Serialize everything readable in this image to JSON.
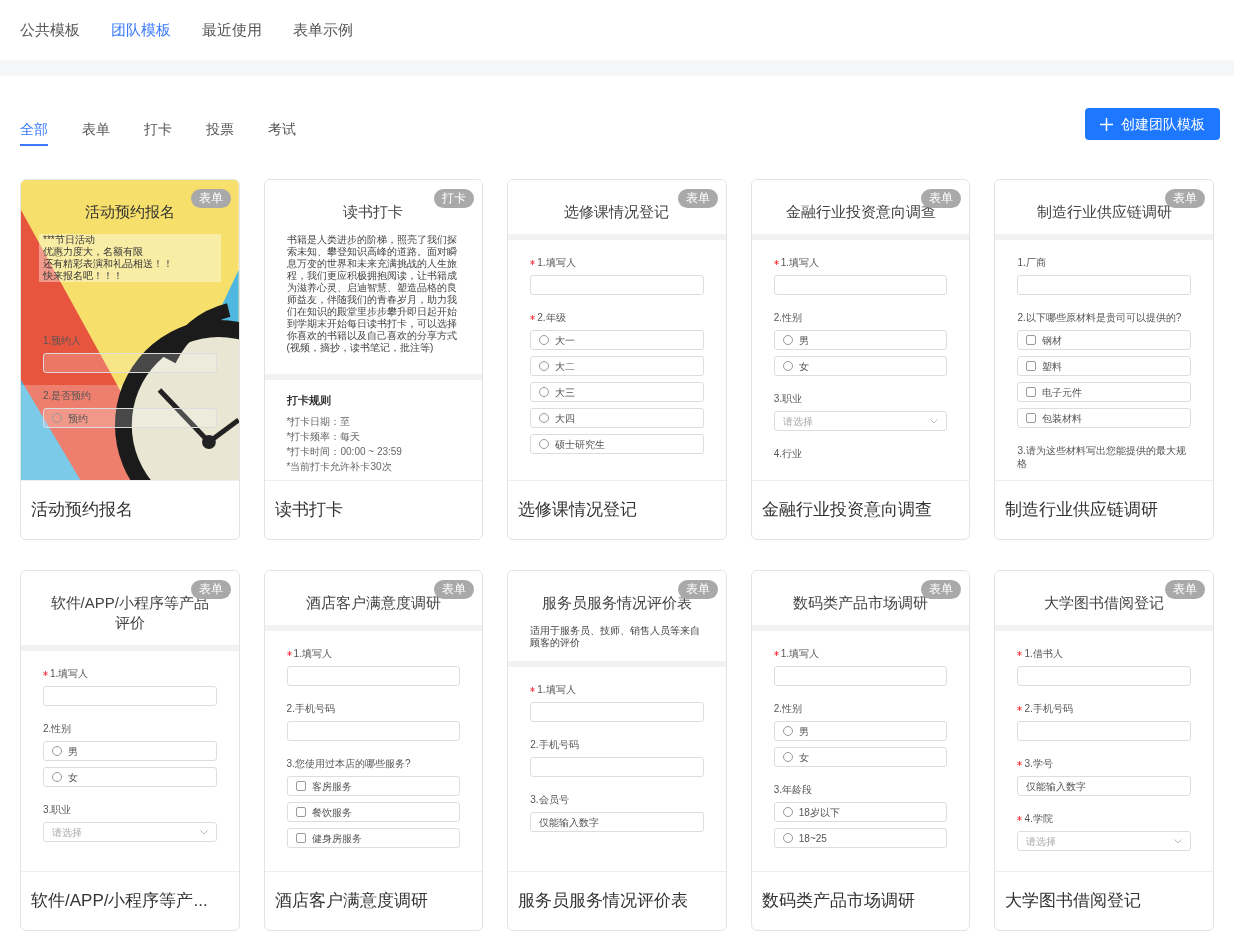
{
  "top_tabs": [
    {
      "label": "公共模板",
      "selected": false
    },
    {
      "label": "团队模板",
      "selected": true
    },
    {
      "label": "最近使用",
      "selected": false
    },
    {
      "label": "表单示例",
      "selected": false
    }
  ],
  "filter_tabs": [
    {
      "label": "全部",
      "selected": true
    },
    {
      "label": "表单",
      "selected": false
    },
    {
      "label": "打卡",
      "selected": false
    },
    {
      "label": "投票",
      "selected": false
    },
    {
      "label": "考试",
      "selected": false
    }
  ],
  "create_button": {
    "label": "创建团队模板"
  },
  "templates": [
    {
      "name": "活动预约报名",
      "tag": "表单",
      "preview": {
        "kind": "photo_form",
        "title": "活动预约报名",
        "description_lines": [
          "***节日活动",
          "优惠力度大，名额有限",
          "还有精彩表演和礼品相送！！",
          "快来报名吧！！！"
        ],
        "questions": [
          {
            "kind": "text",
            "label": "1.预约人",
            "required": false
          },
          {
            "kind": "radio",
            "label": "2.是否预约",
            "required": false,
            "options": [
              "预约"
            ]
          }
        ]
      }
    },
    {
      "name": "读书打卡",
      "tag": "打卡",
      "preview": {
        "kind": "checkin",
        "title": "读书打卡",
        "description": "书籍是人类进步的阶梯，照亮了我们探索未知、攀登知识高峰的道路。面对瞬息万变的世界和未来充满挑战的人生旅程，我们更应积极拥抱阅读，让书籍成为滋养心灵、启迪智慧、塑造品格的良师益友，伴随我们的青春岁月，助力我们在知识的殿堂里步步攀升即日起开始到学期末开始每日读书打卡，可以选择你喜欢的书籍以及自己喜欢的分享方式(视频，摘抄，读书笔记，批注等)",
        "rules_title": "打卡规则",
        "rules": [
          "*打卡日期：至",
          "*打卡频率：每天",
          "*打卡时间：00:00 ~ 23:59",
          "*当前打卡允许补卡30次"
        ]
      }
    },
    {
      "name": "选修课情况登记",
      "tag": "表单",
      "preview": {
        "kind": "form",
        "title": "选修课情况登记",
        "questions": [
          {
            "kind": "text",
            "label": "1.填写人",
            "required": true
          },
          {
            "kind": "radio",
            "label": "2.年级",
            "required": true,
            "options": [
              "大一",
              "大二",
              "大三",
              "大四",
              "硕士研究生"
            ]
          }
        ]
      }
    },
    {
      "name": "金融行业投资意向调查",
      "tag": "表单",
      "preview": {
        "kind": "form",
        "title": "金融行业投资意向调查",
        "questions": [
          {
            "kind": "text",
            "label": "1.填写人",
            "required": true
          },
          {
            "kind": "radio",
            "label": "2.性别",
            "required": false,
            "options": [
              "男",
              "女"
            ]
          },
          {
            "kind": "select",
            "label": "3.职业",
            "required": false,
            "placeholder": "请选择"
          },
          {
            "kind": "label",
            "label": "4.行业",
            "required": false
          }
        ]
      }
    },
    {
      "name": "制造行业供应链调研",
      "tag": "表单",
      "preview": {
        "kind": "form",
        "title": "制造行业供应链调研",
        "questions": [
          {
            "kind": "text",
            "label": "1.厂商",
            "required": false
          },
          {
            "kind": "checkbox",
            "label": "2.以下哪些原材料是贵司可以提供的?",
            "required": false,
            "options": [
              "钢材",
              "塑料",
              "电子元件",
              "包装材料"
            ]
          },
          {
            "kind": "label",
            "label": "3.请为这些材料写出您能提供的最大规格",
            "required": false
          }
        ]
      }
    },
    {
      "name": "软件/APP/小程序等产...",
      "tag": "表单",
      "preview": {
        "kind": "form",
        "title": "软件/APP/小程序等产品评价",
        "questions": [
          {
            "kind": "text",
            "label": "1.填写人",
            "required": true
          },
          {
            "kind": "radio",
            "label": "2.性别",
            "required": false,
            "options": [
              "男",
              "女"
            ]
          },
          {
            "kind": "select",
            "label": "3.职业",
            "required": false,
            "placeholder": "请选择"
          }
        ]
      }
    },
    {
      "name": "酒店客户满意度调研",
      "tag": "表单",
      "preview": {
        "kind": "form",
        "title": "酒店客户满意度调研",
        "questions": [
          {
            "kind": "text",
            "label": "1.填写人",
            "required": true
          },
          {
            "kind": "text",
            "label": "2.手机号码",
            "required": false
          },
          {
            "kind": "checkbox",
            "label": "3.您使用过本店的哪些服务?",
            "required": false,
            "options": [
              "客房服务",
              "餐饮服务",
              "健身房服务"
            ]
          }
        ]
      }
    },
    {
      "name": "服务员服务情况评价表",
      "tag": "表单",
      "preview": {
        "kind": "form",
        "title": "服务员服务情况评价表",
        "description": "适用于服务员、技师、销售人员等来自顾客的评价",
        "questions": [
          {
            "kind": "text",
            "label": "1.填写人",
            "required": true
          },
          {
            "kind": "text",
            "label": "2.手机号码",
            "required": false
          },
          {
            "kind": "text",
            "label": "3.会员号",
            "required": false,
            "placeholder": "仅能输入数字"
          }
        ]
      }
    },
    {
      "name": "数码类产品市场调研",
      "tag": "表单",
      "preview": {
        "kind": "form",
        "title": "数码类产品市场调研",
        "questions": [
          {
            "kind": "text",
            "label": "1.填写人",
            "required": true
          },
          {
            "kind": "radio",
            "label": "2.性别",
            "required": false,
            "options": [
              "男",
              "女"
            ]
          },
          {
            "kind": "radio",
            "label": "3.年龄段",
            "required": false,
            "options": [
              "18岁以下",
              "18~25"
            ]
          }
        ]
      }
    },
    {
      "name": "大学图书借阅登记",
      "tag": "表单",
      "preview": {
        "kind": "form",
        "title": "大学图书借阅登记",
        "questions": [
          {
            "kind": "text",
            "label": "1.借书人",
            "required": true
          },
          {
            "kind": "text",
            "label": "2.手机号码",
            "required": true
          },
          {
            "kind": "text",
            "label": "3.学号",
            "required": true,
            "placeholder": "仅能输入数字"
          },
          {
            "kind": "select",
            "label": "4.学院",
            "required": true,
            "placeholder": "请选择"
          }
        ]
      }
    }
  ]
}
